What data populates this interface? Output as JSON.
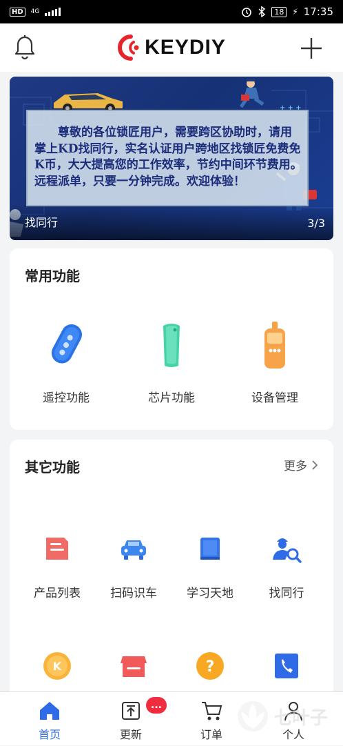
{
  "status_bar": {
    "network_hd": "HD",
    "network_type": "4G",
    "battery_level": "18",
    "time": "17:35"
  },
  "header": {
    "brand": "KEYDIY",
    "left_icon": "bell-icon",
    "right_icon": "plus-icon"
  },
  "banner": {
    "text": "尊敬的各位锁匠用户，需要跨区协助时，请用掌上KD找同行，实名认证用户跨地区找锁匠免费免 K币，大大提高您的工作效率，节约中间环节费用。远程派单，只要一分钟完成。欢迎体验！",
    "title": "找同行",
    "pager": "3/3"
  },
  "common_functions": {
    "title": "常用功能",
    "items": [
      {
        "label": "遥控功能",
        "icon": "car-remote-key-icon"
      },
      {
        "label": "芯片功能",
        "icon": "transponder-chip-icon"
      },
      {
        "label": "设备管理",
        "icon": "key-tool-device-icon"
      }
    ]
  },
  "other_functions": {
    "title": "其它功能",
    "more_label": "更多",
    "items": [
      {
        "label": "产品列表",
        "icon": "product-list-icon"
      },
      {
        "label": "扫码识车",
        "icon": "car-scan-icon"
      },
      {
        "label": "学习天地",
        "icon": "book-icon"
      },
      {
        "label": "找同行",
        "icon": "find-locksmith-icon"
      }
    ],
    "second_row_icons": [
      "k-coin-icon",
      "store-icon",
      "help-icon",
      "phone-icon"
    ]
  },
  "tab_bar": {
    "items": [
      {
        "label": "首页",
        "icon": "home-icon",
        "active": true
      },
      {
        "label": "更新",
        "icon": "update-icon",
        "active": false
      },
      {
        "label": "订单",
        "icon": "cart-icon",
        "active": false
      },
      {
        "label": "个人",
        "icon": "person-icon",
        "active": false
      }
    ],
    "update_badge": "...",
    "watermark": "七叶子"
  },
  "colors": {
    "accent_blue": "#2f6be6",
    "brand_red": "#e5252b",
    "badge_red": "#ef2d3f",
    "banner_navy": "#1f3a82"
  }
}
